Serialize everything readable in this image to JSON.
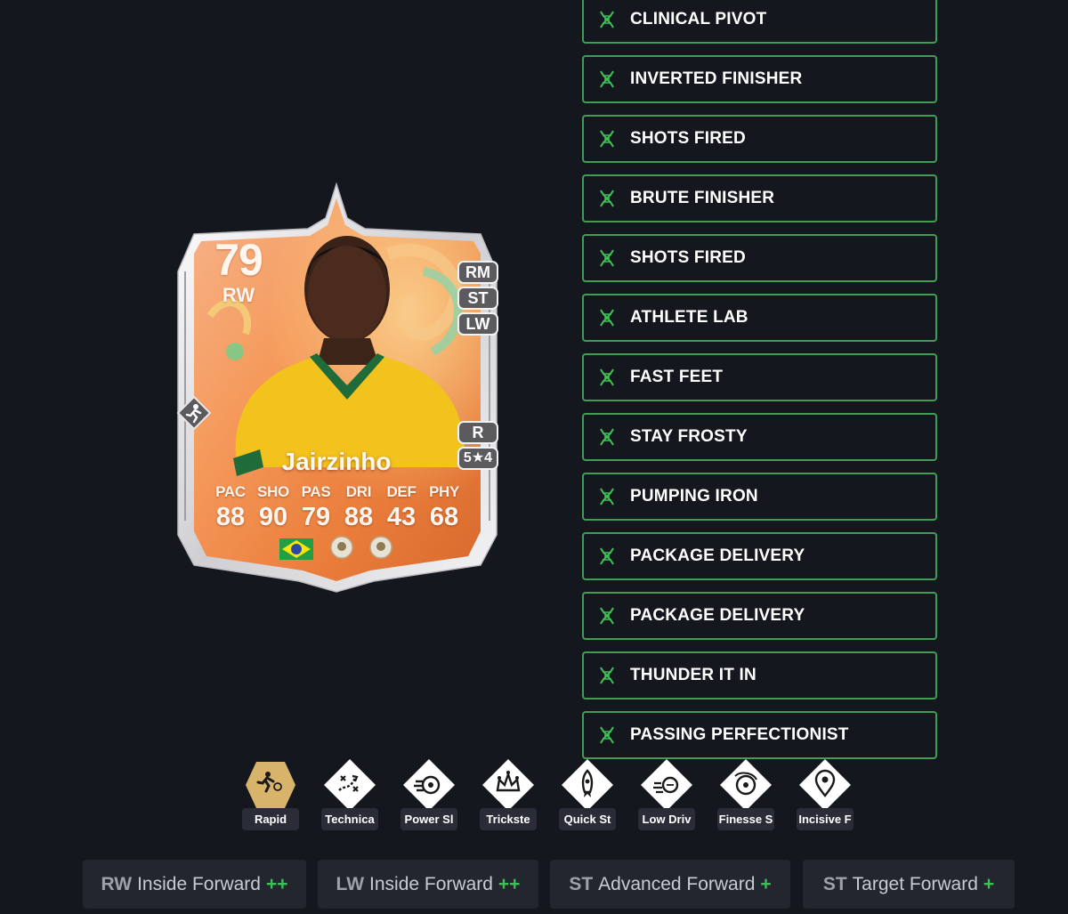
{
  "card": {
    "rating": "79",
    "position": "RW",
    "alt_positions": [
      "RM",
      "ST",
      "LW"
    ],
    "foot": "R",
    "skill_weak": "5★4",
    "name": "Jairzinho",
    "stats": [
      {
        "label": "PAC",
        "value": "88"
      },
      {
        "label": "SHO",
        "value": "90"
      },
      {
        "label": "PAS",
        "value": "79"
      },
      {
        "label": "DRI",
        "value": "88"
      },
      {
        "label": "DEF",
        "value": "43"
      },
      {
        "label": "PHY",
        "value": "68"
      }
    ],
    "nation_icon": "brazil-flag-icon",
    "colors": {
      "card_bg": "#f08a4b",
      "frame": "#e8e8ea"
    }
  },
  "playstyle_list": [
    {
      "label": "CLINICAL PIVOT"
    },
    {
      "label": "INVERTED FINISHER"
    },
    {
      "label": "SHOTS FIRED"
    },
    {
      "label": "BRUTE FINISHER"
    },
    {
      "label": "SHOTS FIRED"
    },
    {
      "label": "ATHLETE LAB"
    },
    {
      "label": "FAST FEET"
    },
    {
      "label": "STAY FROSTY"
    },
    {
      "label": "PUMPING IRON"
    },
    {
      "label": "PACKAGE DELIVERY"
    },
    {
      "label": "PACKAGE DELIVERY"
    },
    {
      "label": "THUNDER IT IN"
    },
    {
      "label": "PASSING PERFECTIONIST"
    }
  ],
  "playstyle_icon": "dna-icon",
  "playstyles": [
    {
      "label": "Rapid",
      "icon": "running-ball-icon",
      "plus": true
    },
    {
      "label": "Technica",
      "icon": "tactics-icon",
      "plus": false
    },
    {
      "label": "Power Sl",
      "icon": "power-shot-icon",
      "plus": false
    },
    {
      "label": "Trickste",
      "icon": "jester-icon",
      "plus": false
    },
    {
      "label": "Quick St",
      "icon": "rocket-icon",
      "plus": false
    },
    {
      "label": "Low Driv",
      "icon": "low-driven-shot-icon",
      "plus": false
    },
    {
      "label": "Finesse S",
      "icon": "finesse-shot-icon",
      "plus": false
    },
    {
      "label": "Incisive F",
      "icon": "map-pin-icon",
      "plus": false
    }
  ],
  "roles": [
    {
      "pos": "RW",
      "name": "Inside Forward",
      "plus": "++"
    },
    {
      "pos": "LW",
      "name": "Inside Forward",
      "plus": "++"
    },
    {
      "pos": "ST",
      "name": "Advanced Forward",
      "plus": "+"
    },
    {
      "pos": "ST",
      "name": "Target Forward",
      "plus": "+"
    }
  ],
  "colors": {
    "page_bg": "#15171e",
    "accent_green": "#3f9d56",
    "plus_green": "#3fbf57",
    "chip_bg": "#2a2d38",
    "gold": "#d8b46a"
  }
}
